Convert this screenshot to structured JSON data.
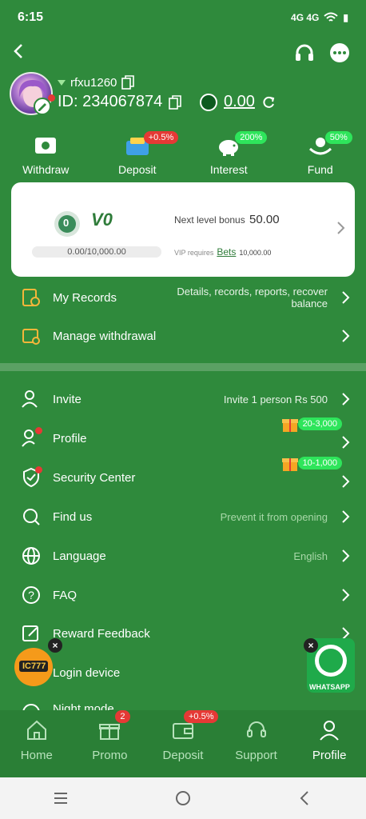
{
  "status_bar": {
    "time": "6:15",
    "network": "4G 4G",
    "battery": "▮"
  },
  "profile": {
    "username": "rfxu1260",
    "id_text": "ID: 234067874",
    "balance": "0.00"
  },
  "actions": [
    {
      "label": "Withdraw",
      "badge": ""
    },
    {
      "label": "Deposit",
      "badge": "+0.5%"
    },
    {
      "label": "Interest",
      "badge": "200%"
    },
    {
      "label": "Fund",
      "badge": "50%"
    }
  ],
  "vip": {
    "badge_level": "0",
    "level": "V0",
    "progress": "0.00/10,000.00",
    "progress_fraction": 0,
    "next_label": "Next level bonus",
    "next_value": "50.00",
    "req_prefix": "VIP requires",
    "req_link": "Bets",
    "req_value": "10,000.00"
  },
  "records": {
    "my_records": {
      "label": "My Records",
      "detail_line1": "Details, records, reports, recover",
      "detail_line2": "balance"
    },
    "manage_withdrawal": {
      "label": "Manage withdrawal"
    }
  },
  "menu": [
    {
      "label": "Invite",
      "detail": "Invite 1 person Rs 500"
    },
    {
      "label": "Profile",
      "gift": "20-3,000"
    },
    {
      "label": "Security Center",
      "gift": "10-1,000"
    },
    {
      "label": "Find us",
      "detail": "Prevent it from opening"
    },
    {
      "label": "Language",
      "detail": "English"
    },
    {
      "label": "FAQ"
    },
    {
      "label": "Reward Feedback"
    },
    {
      "label": "Login device"
    },
    {
      "label": "Night mode"
    }
  ],
  "floating": {
    "ic_logo": "IC777",
    "whatsapp": "WHATSAPP"
  },
  "bottom_nav": [
    {
      "label": "Home",
      "badge": ""
    },
    {
      "label": "Promo",
      "badge": "2"
    },
    {
      "label": "Deposit",
      "badge": "+0.5%"
    },
    {
      "label": "Support",
      "badge": ""
    },
    {
      "label": "Profile",
      "badge": ""
    }
  ],
  "colors": {
    "bg": "#2f8a3c",
    "accent_green": "#2ee55b",
    "accent_red": "#e53935",
    "card_bg": "#ffffff"
  }
}
